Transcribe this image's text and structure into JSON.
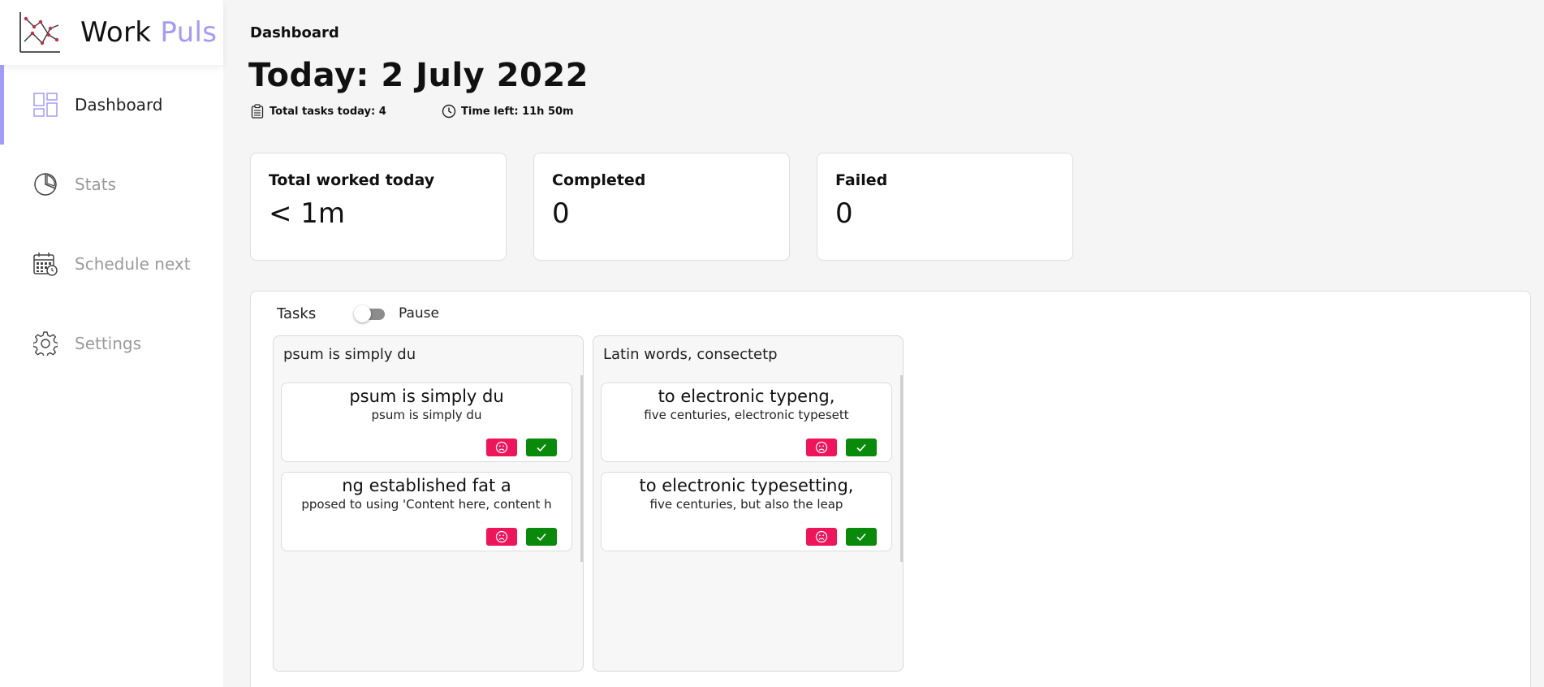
{
  "app": {
    "name_main": "Work",
    "name_accent": "Puls",
    "accent_color": "#a29bfe"
  },
  "sidebar": {
    "items": [
      {
        "label": "Dashboard",
        "icon": "dashboard-grid-icon",
        "active": true
      },
      {
        "label": "Stats",
        "icon": "pie-chart-icon",
        "active": false
      },
      {
        "label": "Schedule next",
        "icon": "calendar-clock-icon",
        "active": false
      },
      {
        "label": "Settings",
        "icon": "gear-icon",
        "active": false
      }
    ]
  },
  "header": {
    "breadcrumb": "Dashboard",
    "title": "Today: 2 July 2022",
    "total_tasks": "Total tasks today: 4",
    "time_left": "Time left: 11h 50m"
  },
  "cards": [
    {
      "title": "Total worked today",
      "value": "< 1m"
    },
    {
      "title": "Completed",
      "value": "0"
    },
    {
      "title": "Failed",
      "value": "0"
    }
  ],
  "tasks": {
    "label": "Tasks",
    "pause_label": "Pause",
    "pause_on": false,
    "columns": [
      {
        "title": "psum is simply du",
        "items": [
          {
            "title": "psum is simply du",
            "subtitle": "psum is simply du"
          },
          {
            "title": "ng established fat a",
            "subtitle": "pposed to using 'Content here, content h"
          }
        ]
      },
      {
        "title": "Latin words, consectetp",
        "items": [
          {
            "title": "to electronic typeng,",
            "subtitle": "five centuries, electronic typesett"
          },
          {
            "title": "to electronic typesetting,",
            "subtitle": "five centuries, but also the leap"
          }
        ]
      }
    ]
  },
  "colors": {
    "fail_button": "#f0145a",
    "done_button": "#0a8a0a"
  }
}
